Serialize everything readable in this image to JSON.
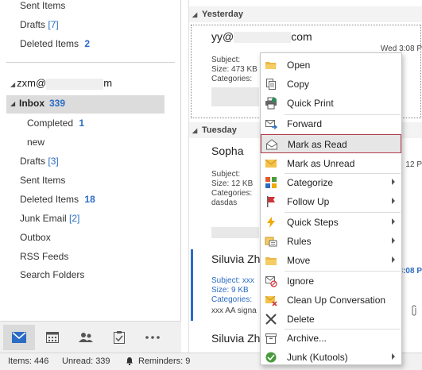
{
  "folders_top": [
    {
      "label": "Sent Items",
      "count": ""
    },
    {
      "label": "Drafts",
      "count": "[7]"
    },
    {
      "label": "Deleted Items",
      "count": "2"
    }
  ],
  "account": {
    "prefix": "zxm@",
    "suffix": "m"
  },
  "inbox": {
    "label": "Inbox",
    "count": "339"
  },
  "subfolders": [
    {
      "label": "Completed",
      "count": "1"
    },
    {
      "label": "new",
      "count": ""
    }
  ],
  "folders_bottom": [
    {
      "label": "Drafts",
      "count": "[3]"
    },
    {
      "label": "Sent Items",
      "count": ""
    },
    {
      "label": "Deleted Items",
      "count": "18"
    },
    {
      "label": "Junk Email",
      "count": "[2]"
    },
    {
      "label": "Outbox",
      "count": ""
    },
    {
      "label": "RSS Feeds",
      "count": ""
    },
    {
      "label": "Search Folders",
      "count": ""
    }
  ],
  "nav": {
    "items": [
      "mail-icon",
      "calendar-icon",
      "people-icon",
      "tasks-icon",
      "more-icon"
    ]
  },
  "status": {
    "items": "Items: 446",
    "unread": "Unread: 339",
    "reminders": "Reminders: 9"
  },
  "groups": {
    "yesterday": "Yesterday",
    "tuesday": "Tuesday"
  },
  "messages": [
    {
      "sender_start": "yy@",
      "sender_end": "com",
      "date": "Wed 3:08 P",
      "subject": "Subject:",
      "size": "Size: 473 KB",
      "categories": "Categories:",
      "preview": ""
    },
    {
      "sender_start": "Sopha",
      "sender_end": "",
      "date": "12 P",
      "subject": "Subject:",
      "size": "Size: 12 KB",
      "categories": "Categories:",
      "preview": "dasdas"
    },
    {
      "sender_start": "Siluvia Zh",
      "sender_end": "",
      "date": "3:08 P",
      "subject": "Subject: xxx",
      "size": "Size: 9 KB",
      "categories": "Categories:",
      "preview": "xxx AA signa"
    },
    {
      "sender_start": "Siluvia Zh",
      "sender_end": "",
      "date": "",
      "subject": "",
      "size": "",
      "categories": "",
      "preview": ""
    }
  ],
  "context_menu": {
    "items": [
      {
        "label": "Open",
        "icon": "open-folder-icon",
        "submenu": false
      },
      {
        "label": "Copy",
        "icon": "copy-icon",
        "submenu": false
      },
      {
        "label": "Quick Print",
        "icon": "printer-icon",
        "submenu": false
      },
      {
        "label": "Forward",
        "icon": "forward-icon",
        "submenu": false
      },
      {
        "label": "Mark as Read",
        "icon": "envelope-open-icon",
        "submenu": false
      },
      {
        "label": "Mark as Unread",
        "icon": "envelope-icon",
        "submenu": false
      },
      {
        "label": "Categorize",
        "icon": "categorize-icon",
        "submenu": true
      },
      {
        "label": "Follow Up",
        "icon": "flag-icon",
        "submenu": true
      },
      {
        "label": "Quick Steps",
        "icon": "lightning-icon",
        "submenu": true
      },
      {
        "label": "Rules",
        "icon": "rules-icon",
        "submenu": true
      },
      {
        "label": "Move",
        "icon": "move-folder-icon",
        "submenu": true
      },
      {
        "label": "Ignore",
        "icon": "ignore-icon",
        "submenu": false
      },
      {
        "label": "Clean Up Conversation",
        "icon": "cleanup-icon",
        "submenu": false
      },
      {
        "label": "Delete",
        "icon": "delete-icon",
        "submenu": false
      },
      {
        "label": "Archive...",
        "icon": "archive-icon",
        "submenu": false
      },
      {
        "label": "Junk (Kutools)",
        "icon": "junk-icon",
        "submenu": true
      }
    ]
  },
  "colors": {
    "accent": "#2b6cc4",
    "hover_border": "#b13a4a",
    "flag": "#d13438",
    "quickstep": "#f2a900"
  }
}
